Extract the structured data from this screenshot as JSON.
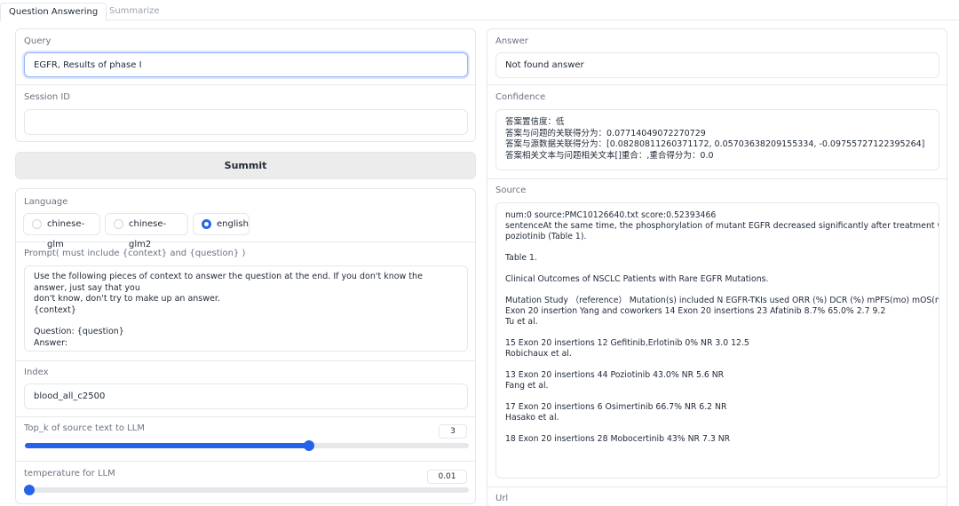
{
  "tabs": [
    {
      "label": "Question Answering"
    },
    {
      "label": "Summarize"
    }
  ],
  "query": {
    "label": "Query",
    "value": "EGFR, Results of phase I"
  },
  "session": {
    "label": "Session ID",
    "value": ""
  },
  "submit_label": "Summit",
  "language": {
    "label": "Language",
    "options": [
      "chinese-glm",
      "chinese-glm2",
      "english"
    ],
    "selected": "english"
  },
  "prompt": {
    "label": "Prompt( must include {context} and {question} )",
    "lines": [
      "Use the following pieces of context to answer the question at the end. If you don't know the answer, just say that you",
      "don't know, don't try to make up an answer.",
      "{context}",
      "",
      "Question: {question}",
      "Answer:"
    ]
  },
  "index": {
    "label": "Index",
    "value": "blood_all_c2500"
  },
  "top_k": {
    "label": "Top_k of source text to LLM",
    "value": "3",
    "fraction": 0.64
  },
  "temperature": {
    "label": "temperature for LLM",
    "value": "0.01",
    "fraction": 0.01
  },
  "answer": {
    "label": "Answer",
    "value": "Not found answer"
  },
  "confidence": {
    "label": "Confidence",
    "lines": [
      "答案置信度：低",
      "答案与问题的关联得分为：0.07714049072270729",
      "答案与源数据关联得分为：[0.08280811260371172, 0.05703638209155334, -0.09755727122395264]",
      "答案相关文本与问题相关文本[]重合：,重合得分为：0.0"
    ]
  },
  "source": {
    "label": "Source",
    "lines": [
      "num:0   source:PMC10126640.txt   score:0.52393466",
      "sentenceAt the same time, the phosphorylation of mutant EGFR decreased significantly after treatment with",
      "poziotinib (Table 1).",
      "",
      "Table 1.",
      "",
      "Clinical Outcomes of NSCLC Patients with Rare EGFR Mutations.",
      "",
      "Mutation Study （reference） Mutation(s) included N EGFR-TKIs used   ORR (%)  DCR (%)  mPFS(mo)  mOS(mo)",
      "Exon 20 insertion   Yang and coworkers 14 Exon 20 insertions  23  Afatinib   8.7% 65.0%  2.7 9.2",
      "Tu et al.",
      "",
      "15  Exon 20 insertions  12  Gefitinib,Erlotinib  0% NR 3.0 12.5",
      "Robichaux et al.",
      "",
      "13  Exon 20 insertions  44  Poziotinib  43.0%  NR 5.6 NR",
      "Fang et al.",
      "",
      "17  Exon 20 insertions  6 Osimertinib  66.7%  NR 6.2 NR",
      "Hasako et al.",
      "",
      "18  Exon 20 insertions  28  Mobocertinib   43%  NR 7.3 NR"
    ]
  },
  "url": {
    "label": "Url"
  }
}
